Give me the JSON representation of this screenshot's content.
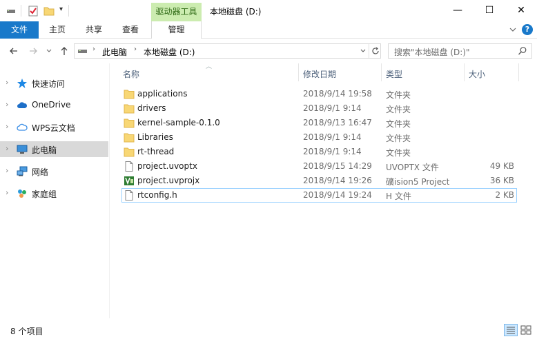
{
  "window": {
    "title": "本地磁盘 (D:)",
    "context_tab_label": "驱动器工具",
    "minimize_glyph": "—",
    "maximize_glyph": "☐",
    "close_glyph": "✕"
  },
  "ribbon": {
    "tabs": [
      "文件",
      "主页",
      "共享",
      "查看",
      "管理"
    ],
    "help_glyph": "?"
  },
  "address": {
    "segments": [
      "此电脑",
      "本地磁盘 (D:)"
    ],
    "search_placeholder": "搜索\"本地磁盘 (D:)\""
  },
  "nav": {
    "items": [
      {
        "label": "快速访问",
        "icon": "star-icon"
      },
      {
        "label": "OneDrive",
        "icon": "cloud-icon"
      },
      {
        "label": "WPS云文档",
        "icon": "wps-cloud-icon"
      },
      {
        "label": "此电脑",
        "icon": "computer-icon"
      },
      {
        "label": "网络",
        "icon": "network-icon"
      },
      {
        "label": "家庭组",
        "icon": "homegroup-icon"
      }
    ]
  },
  "columns": {
    "name": "名称",
    "date": "修改日期",
    "type": "类型",
    "size": "大小"
  },
  "files": [
    {
      "name": "applications",
      "date": "2018/9/14 19:58",
      "type": "文件夹",
      "size": "",
      "icon": "folder-icon"
    },
    {
      "name": "drivers",
      "date": "2018/9/1 9:14",
      "type": "文件夹",
      "size": "",
      "icon": "folder-icon"
    },
    {
      "name": "kernel-sample-0.1.0",
      "date": "2018/9/13 16:47",
      "type": "文件夹",
      "size": "",
      "icon": "folder-icon"
    },
    {
      "name": "Libraries",
      "date": "2018/9/1 9:14",
      "type": "文件夹",
      "size": "",
      "icon": "folder-icon"
    },
    {
      "name": "rt-thread",
      "date": "2018/9/1 9:14",
      "type": "文件夹",
      "size": "",
      "icon": "folder-icon"
    },
    {
      "name": "project.uvoptx",
      "date": "2018/9/15 14:29",
      "type": "UVOPTX 文件",
      "size": "49 KB",
      "icon": "file-icon"
    },
    {
      "name": "project.uvprojx",
      "date": "2018/9/14 19:26",
      "type": "礦ision5 Project",
      "size": "36 KB",
      "icon": "keil-project-icon"
    },
    {
      "name": "rtconfig.h",
      "date": "2018/9/14 19:24",
      "type": "H 文件",
      "size": "2 KB",
      "icon": "file-icon"
    }
  ],
  "status": {
    "item_count": "8 个项目"
  },
  "colors": {
    "accent": "#1979ca",
    "folder": "#f8d775",
    "context_tab": "#ccecb0"
  }
}
